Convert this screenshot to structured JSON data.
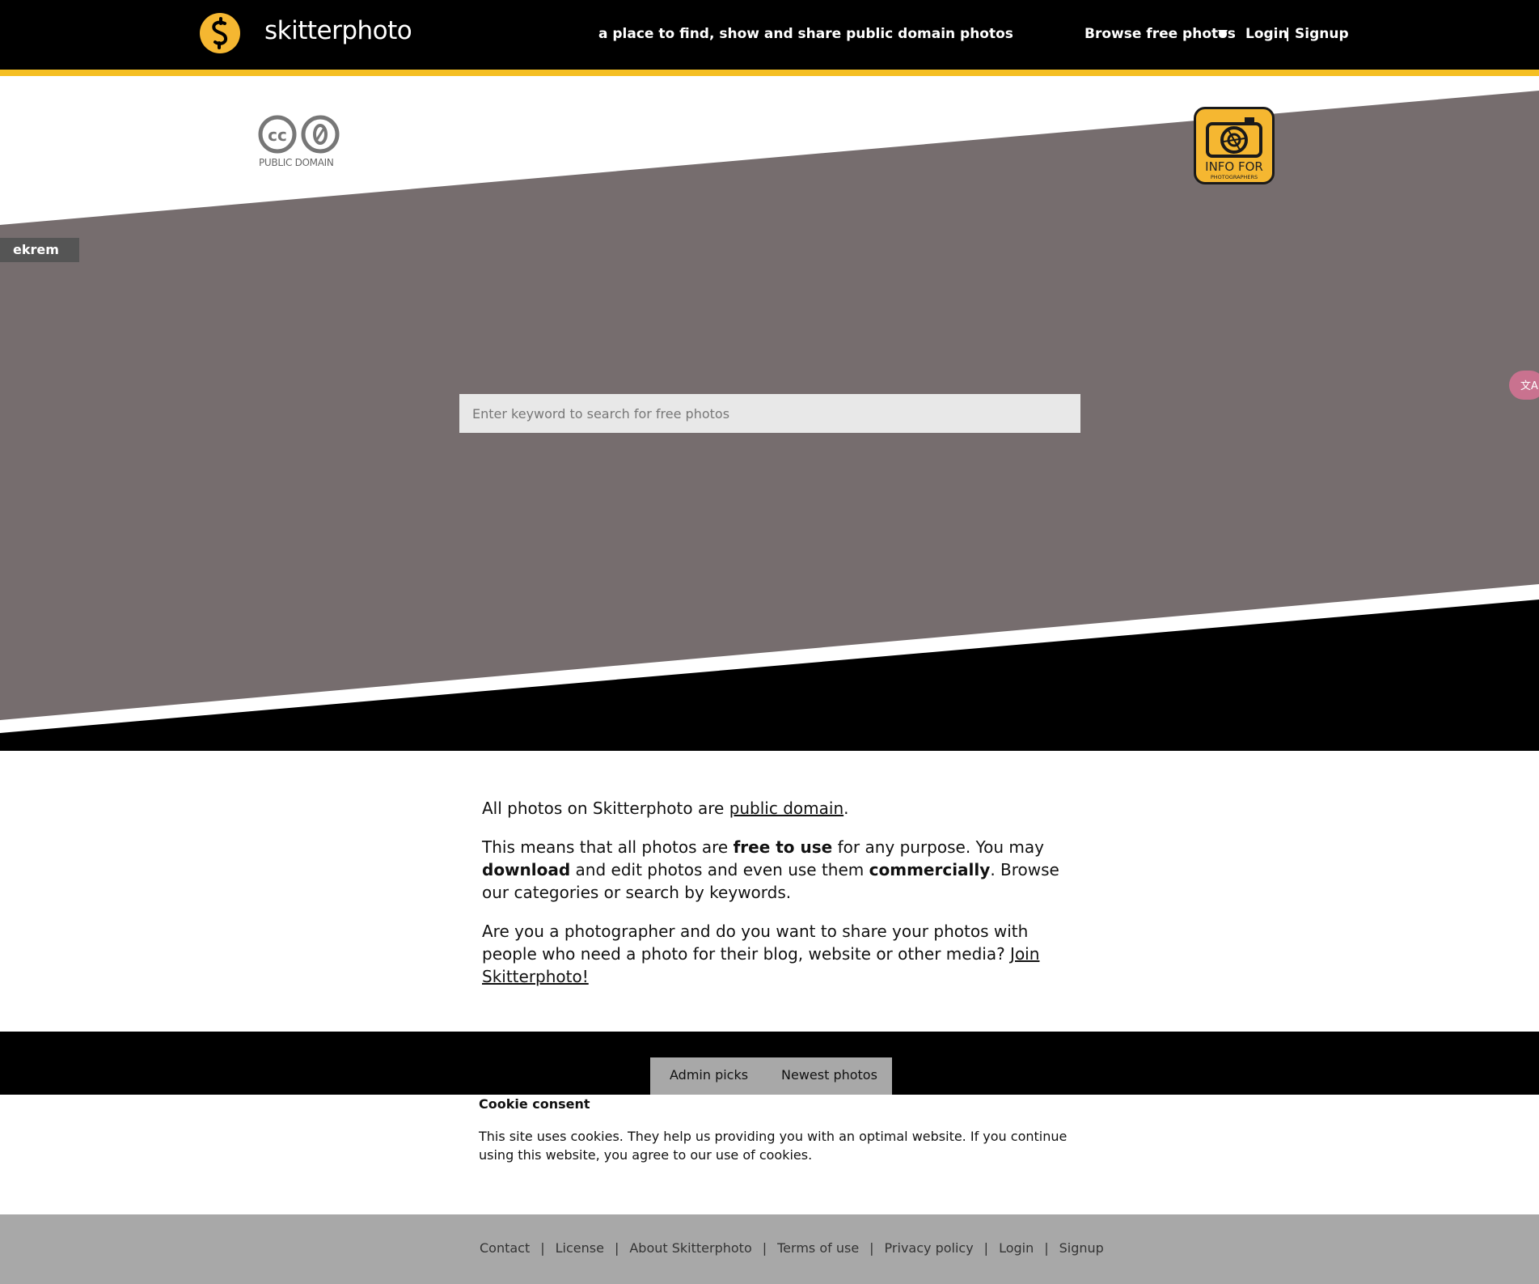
{
  "header": {
    "site_name": "skitterphoto",
    "tagline": "a place to find, show and share public domain photos",
    "browse_label": "Browse free photos",
    "login_label": "Login",
    "separator": "|",
    "signup_label": "Signup"
  },
  "hero": {
    "cc_label": "PUBLIC DOMAIN",
    "info_badge_line1": "INFO FOR",
    "info_badge_line2": "PHOTOGRAPHERS",
    "user_tag": "ekrem",
    "search_placeholder": "Enter keyword to search for free photos",
    "translate_icon_label": "文A"
  },
  "intro": {
    "p1_text": "All photos on Skitterphoto are ",
    "p1_link": "public domain",
    "p1_end": ".",
    "p2_a": "This means that all photos are ",
    "p2_b": "free to use",
    "p2_c": " for any purpose. You may ",
    "p2_d": "download",
    "p2_e": " and edit photos and even use them ",
    "p2_f": "commercially",
    "p2_g": ". Browse our categories or search by keywords.",
    "p3_text": "Are you a photographer and do you want to share your photos with people who need a photo for their blog, website or other media? ",
    "p3_link": "Join Skitterphoto!"
  },
  "tabs": {
    "admin_picks": "Admin picks",
    "newest_photos": "Newest photos"
  },
  "cookie": {
    "title": "Cookie consent",
    "text": "This site uses cookies. They help us providing you with an optimal website. If you continue using this website, you agree to our use of cookies."
  },
  "footer": {
    "links": [
      "Contact",
      "License",
      "About Skitterphoto",
      "Terms of use",
      "Privacy policy",
      "Login",
      "Signup"
    ],
    "separator": "|"
  },
  "colors": {
    "accent_yellow": "#f5b731",
    "hero_gray": "#766d6e",
    "black": "#000000",
    "footer_gray": "#a8a8a8"
  },
  "icons": {
    "logo": "skitterphoto-logo-icon",
    "caret": "triangle-down-icon",
    "cc": "cc-zero-icon",
    "camera": "camera-icon",
    "translate": "translate-icon"
  }
}
